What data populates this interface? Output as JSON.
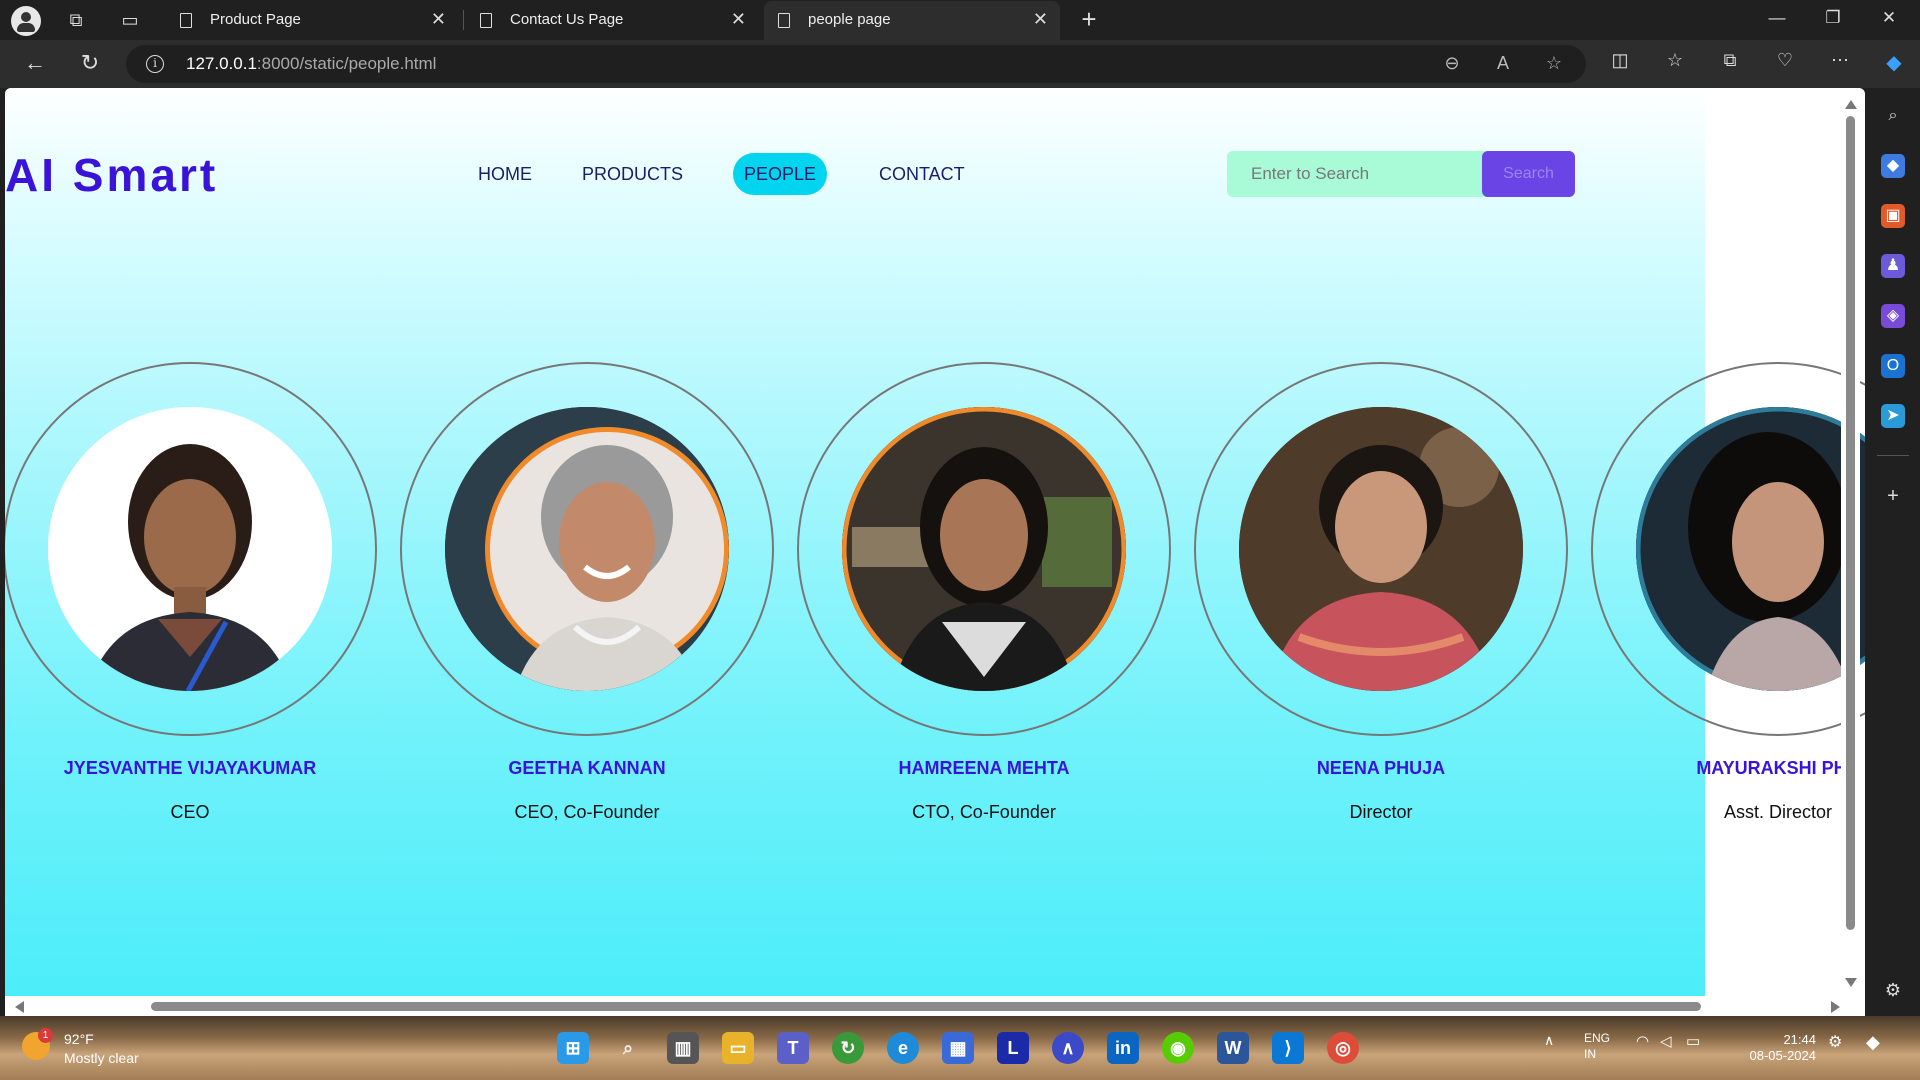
{
  "browser": {
    "tabs": [
      {
        "title": "Product Page",
        "active": false
      },
      {
        "title": "Contact Us Page",
        "active": false
      },
      {
        "title": "people page",
        "active": true
      }
    ],
    "url_host": "127.0.0.1",
    "url_rest": ":8000/static/people.html",
    "new_tab": "+"
  },
  "site": {
    "logo": "AI Smart",
    "nav": [
      "HOME",
      "PRODUCTS",
      "PEOPLE",
      "CONTACT"
    ],
    "active_nav": "PEOPLE",
    "search_placeholder": "Enter to Search",
    "search_button": "Search",
    "people": [
      {
        "name": "JYESVANTHE VIJAYAKUMAR",
        "role": "CEO"
      },
      {
        "name": "GEETHA KANNAN",
        "role": "CEO, Co-Founder"
      },
      {
        "name": "HAMREENA MEHTA",
        "role": "CTO, Co-Founder"
      },
      {
        "name": "NEENA PHUJA",
        "role": "Director"
      },
      {
        "name": "MAYURAKSHI PHU",
        "role": "Asst. Director"
      }
    ]
  },
  "taskbar": {
    "weather_temp": "92°F",
    "weather_desc": "Mostly clear",
    "weather_badge": "1",
    "lang_top": "ENG",
    "lang_bottom": "IN",
    "time": "21:44",
    "date": "08-05-2024"
  }
}
